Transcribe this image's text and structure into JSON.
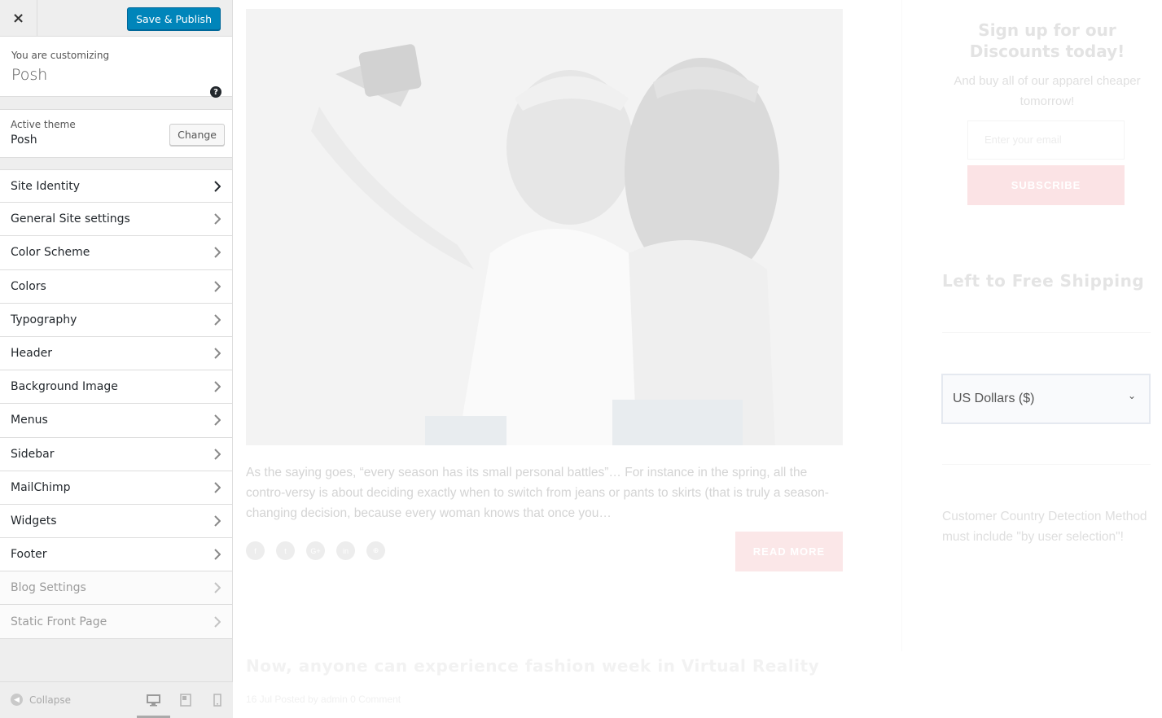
{
  "topbar": {
    "close_glyph": "×",
    "publish_label": "Save & Publish"
  },
  "customizing": {
    "label": "You are customizing",
    "site": "Posh",
    "help_glyph": "?"
  },
  "theme": {
    "label": "Active theme",
    "name": "Posh",
    "change_label": "Change"
  },
  "sections": [
    {
      "label": "Site Identity"
    },
    {
      "label": "General Site settings"
    },
    {
      "label": "Color Scheme"
    },
    {
      "label": "Colors"
    },
    {
      "label": "Typography"
    },
    {
      "label": "Header"
    },
    {
      "label": "Background Image"
    },
    {
      "label": "Menus"
    },
    {
      "label": "Sidebar"
    },
    {
      "label": "MailChimp"
    },
    {
      "label": "Widgets"
    },
    {
      "label": "Footer"
    },
    {
      "label": "Blog Settings"
    },
    {
      "label": "Static Front Page"
    }
  ],
  "footer": {
    "collapse_label": "Collapse"
  },
  "preview": {
    "excerpt": "As the saying goes, “every season has its small personal battles”… For instance in the spring, all the contro-versy is about deciding exactly when to switch from jeans or pants to skirts (that is truly a season-changing decision, because every woman knows that once you…",
    "socials": [
      "f",
      "t",
      "G+",
      "in",
      "⊕"
    ],
    "read_more": "READ MORE",
    "post_title": "Now, anyone can experience fashion week in Virtual Reality",
    "post_meta": "16 Jul Posted by admin 0 Comment"
  },
  "sidebar_widgets": {
    "signup_title": "Sign up for our Discounts today!",
    "signup_sub": "And buy all of our apparel cheaper tomorrow!",
    "email_placeholder": "Enter your email",
    "subscribe_label": "SUBSCRIBE",
    "shipping_title": "Left to Free Shipping",
    "currency_value": "US Dollars ($)",
    "country_note": "Customer Country Detection Method must include \"by user selection\"!"
  },
  "colors": {
    "accent": "#0085ba",
    "pink": "#fbe3e5"
  }
}
